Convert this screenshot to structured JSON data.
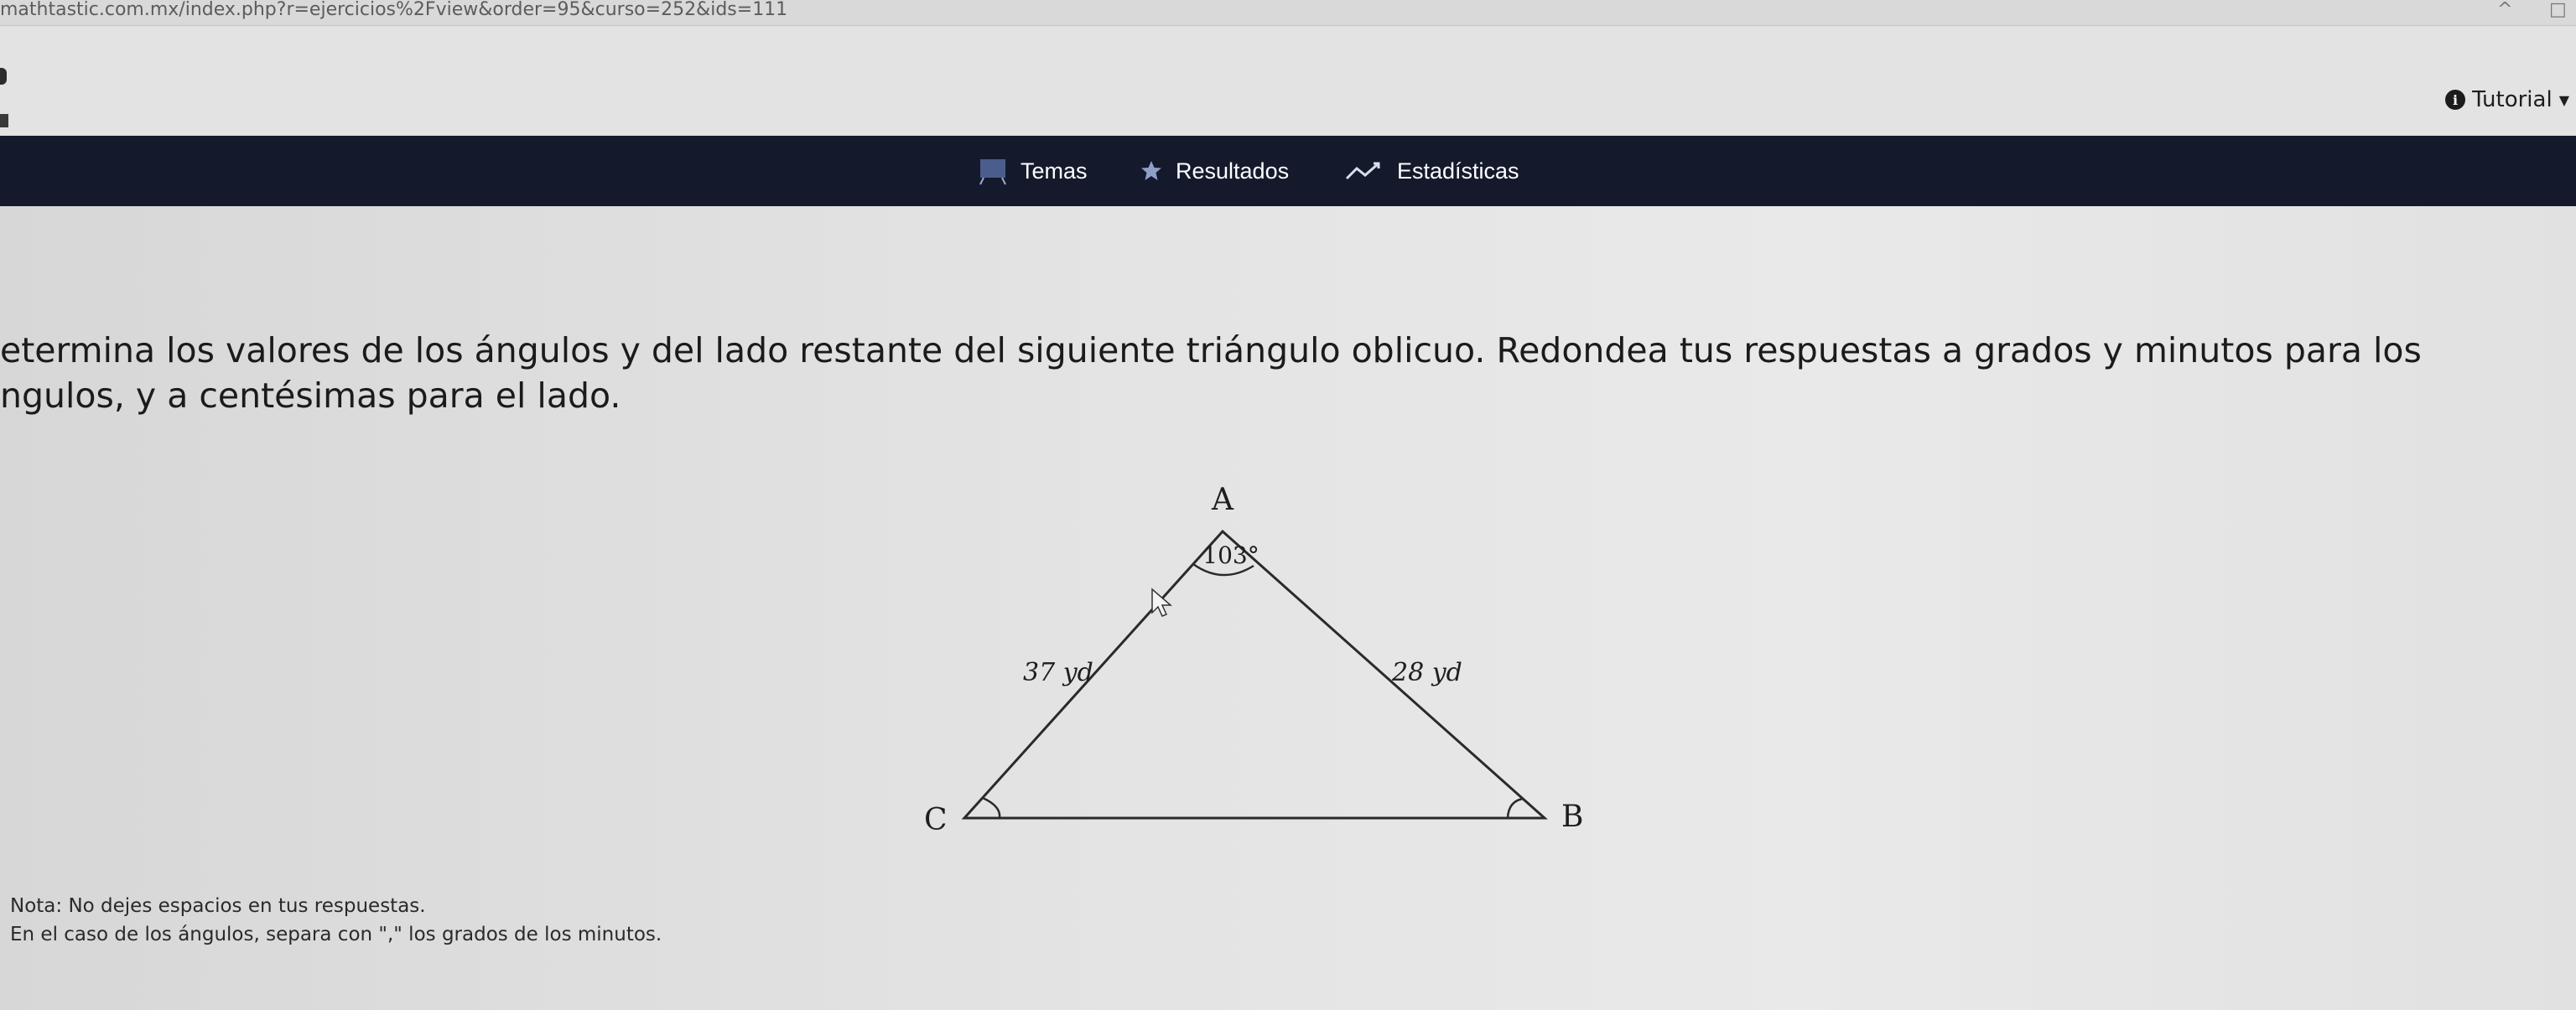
{
  "browser": {
    "url": "mathtastic.com.mx/index.php?r=ejercicios%2Fview&order=95&curso=252&ids=111"
  },
  "header": {
    "tutorial_label": "Tutorial",
    "tutorial_icon": "info-icon"
  },
  "nav": {
    "items": [
      {
        "label": "Temas",
        "icon": "board-icon"
      },
      {
        "label": "Resultados",
        "icon": "star-icon"
      },
      {
        "label": "Estadísticas",
        "icon": "trend-icon"
      }
    ]
  },
  "exercise": {
    "prompt_line1": "etermina los valores de los ángulos y del lado restante del siguiente triángulo oblicuo. Redondea tus respuestas a grados y minutos para los",
    "prompt_line2": "ngulos, y a centésimas para el lado.",
    "triangle": {
      "vertex_a": "A",
      "vertex_b": "B",
      "vertex_c": "C",
      "angle_a": "103°",
      "side_ac": "37 yd",
      "side_ab": "28 yd"
    },
    "note_line1": "Nota: No dejes espacios en tus respuestas.",
    "note_line2": "En el caso de los ángulos, separa con \",\" los grados de los minutos."
  }
}
